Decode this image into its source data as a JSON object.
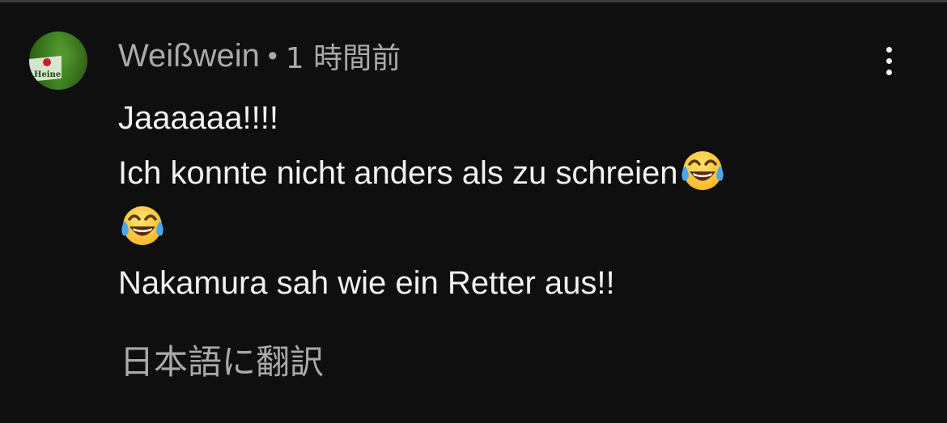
{
  "comment": {
    "author": "Weißwein",
    "separator": "•",
    "timestamp": "1 時間前",
    "body": {
      "line1": "Jaaaaaa!!!!",
      "line2_text": "Ich konnte nicht anders als zu schreien",
      "line4": "Nakamura sah wie ein Retter aus!!"
    },
    "emoji": "face-with-tears-of-joy",
    "translate_label": "日本語に翻訳",
    "avatar_text": "Heineken"
  },
  "colors": {
    "background": "#0f0f0f",
    "primary_text": "#f1f1f1",
    "secondary_text": "#aaaaaa",
    "avatar_green": "#4c8f22"
  }
}
